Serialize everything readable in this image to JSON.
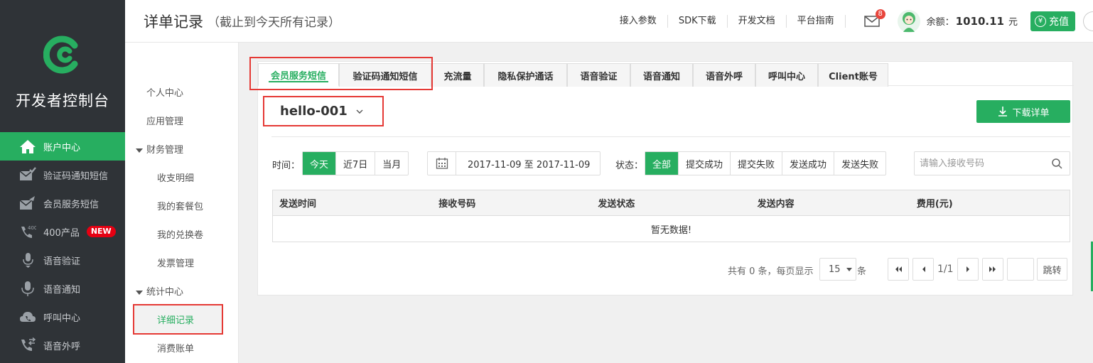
{
  "sidebar": {
    "brand_title": "开发者控制台",
    "items": [
      {
        "label": "账户中心",
        "icon": "home-icon"
      },
      {
        "label": "验证码通知短信",
        "icon": "mail-check-icon"
      },
      {
        "label": "会员服务短信",
        "icon": "mail-send-icon"
      },
      {
        "label": "400产品",
        "icon": "phone-400-icon",
        "badge": "NEW"
      },
      {
        "label": "语音验证",
        "icon": "mic-shield-icon"
      },
      {
        "label": "语音通知",
        "icon": "mic-icon"
      },
      {
        "label": "呼叫中心",
        "icon": "cloud-phone-icon"
      },
      {
        "label": "语音外呼",
        "icon": "phone-out-icon"
      }
    ]
  },
  "header": {
    "title": "详单记录",
    "subtitle": "（截止到今天所有记录）",
    "links": [
      "接入参数",
      "SDK下载",
      "开发文档",
      "平台指南"
    ],
    "mail_count": "8",
    "balance_label": "余额：",
    "balance_value": "1010.11",
    "balance_unit": "元",
    "recharge_label": "充值",
    "recharge_symbol": "¥"
  },
  "submenu": {
    "personal_center": "个人中心",
    "app_management": "应用管理",
    "finance_group": "财务管理",
    "finance_items": [
      "收支明细",
      "我的套餐包",
      "我的兑换卷",
      "发票管理"
    ],
    "stats_group": "统计中心",
    "active_item": "详细记录",
    "bill_item": "消费账单"
  },
  "tabs": [
    "会员服务短信",
    "验证码通知短信",
    "充流量",
    "隐私保护通话",
    "语音验证",
    "语音通知",
    "语音外呼",
    "呼叫中心",
    "Client账号"
  ],
  "app_selector": "hello-001",
  "download_label": "下载详单",
  "filters": {
    "time_label": "时间：",
    "time_options": [
      "今天",
      "近7日",
      "当月"
    ],
    "date_range": "2017-11-09 至 2017-11-09",
    "status_label": "状态：",
    "status_options": [
      "全部",
      "提交成功",
      "提交失败",
      "发送成功",
      "发送失败"
    ],
    "search_placeholder": "请输入接收号码"
  },
  "table": {
    "columns": [
      "发送时间",
      "接收号码",
      "发送状态",
      "发送内容",
      "费用(元)"
    ],
    "empty_text": "暂无数据!"
  },
  "pagination": {
    "total_text": "共有 0 条，每页显示",
    "page_size": "15",
    "unit": "条",
    "page_info": "1/1",
    "jump_label": "跳转"
  },
  "colors": {
    "accent": "#27ae60",
    "sidebar_bg": "#2f3337",
    "highlight_border": "#e53935"
  }
}
